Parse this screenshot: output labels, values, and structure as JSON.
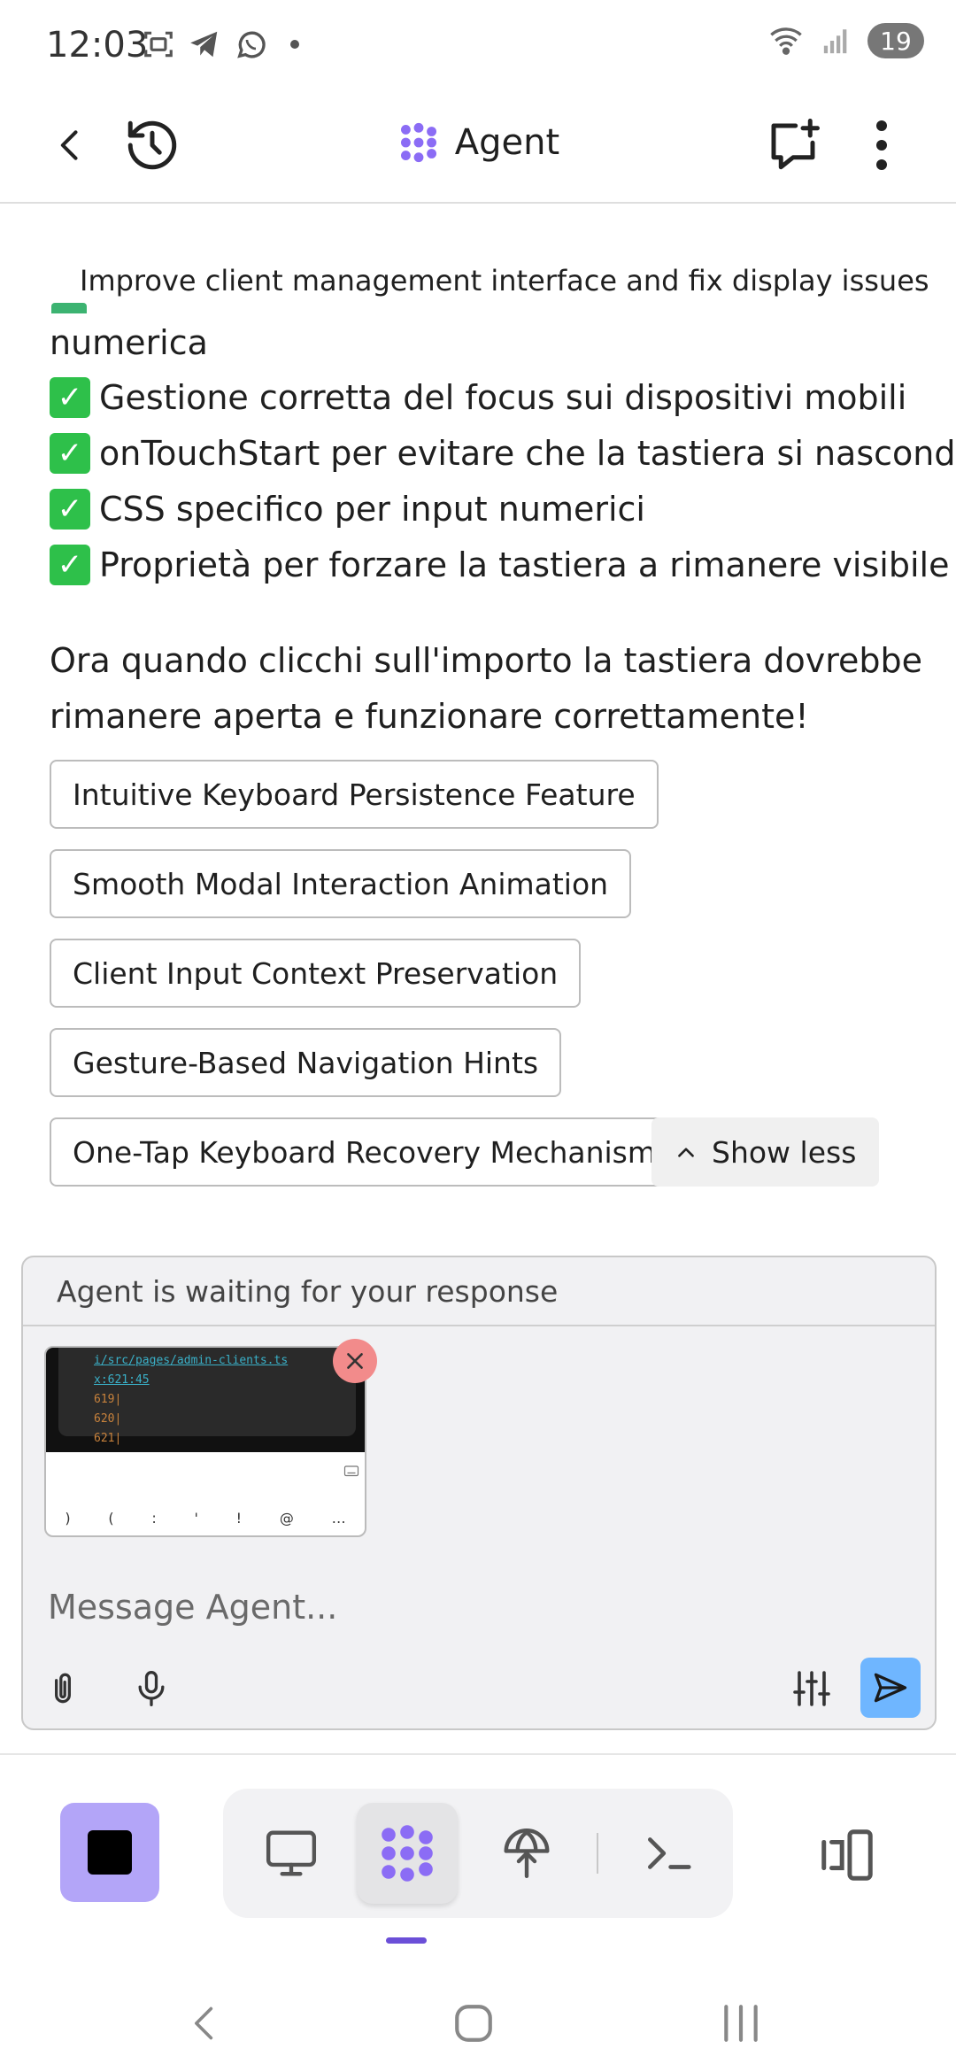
{
  "status_bar": {
    "time": "12:03",
    "battery": "19",
    "icons": [
      "screenshot-icon",
      "telegram-icon",
      "whatsapp-icon",
      "dot-icon",
      "wifi-icon",
      "signal-icon"
    ]
  },
  "header": {
    "title": "Agent",
    "brand_color": "#8b6cf5"
  },
  "chat": {
    "overlay_title": "Improve client management interface and fix display issues",
    "line_numerica": "numerica",
    "checklist": [
      "Gestione corretta del focus sui dispositivi mobili",
      "onTouchStart per evitare che la tastiera si nasconda",
      "CSS specifico per input numerici",
      "Proprietà per forzare la tastiera a rimanere visibile"
    ],
    "conclusion_line1": "Ora quando clicchi sull'importo la tastiera dovrebbe",
    "conclusion_line2": "rimanere aperta e funzionare correttamente!",
    "suggestions": [
      "Intuitive Keyboard Persistence Feature",
      "Smooth Modal Interaction Animation",
      "Client Input Context Preservation",
      "Gesture-Based Navigation Hints",
      "One-Tap Keyboard Recovery Mechanism"
    ],
    "show_less_label": "Show less"
  },
  "composer": {
    "status": "Agent is waiting for your response",
    "placeholder": "Message Agent...",
    "attachment": {
      "code_line1": "i/src/pages/admin-clients.ts",
      "code_line2": "x:621:45",
      "line_a": "619|",
      "line_b": "620|",
      "line_c": "621|",
      "keys": [
        ")",
        "(",
        ":",
        "'",
        "!",
        "@",
        "…"
      ]
    },
    "send_color": "#6fb6ff"
  },
  "toolbar": {
    "stop_color": "#b3a5f8",
    "items": [
      "desktop-icon",
      "agent-icon",
      "deploy-icon",
      "terminal-icon"
    ],
    "active": "agent-icon"
  }
}
